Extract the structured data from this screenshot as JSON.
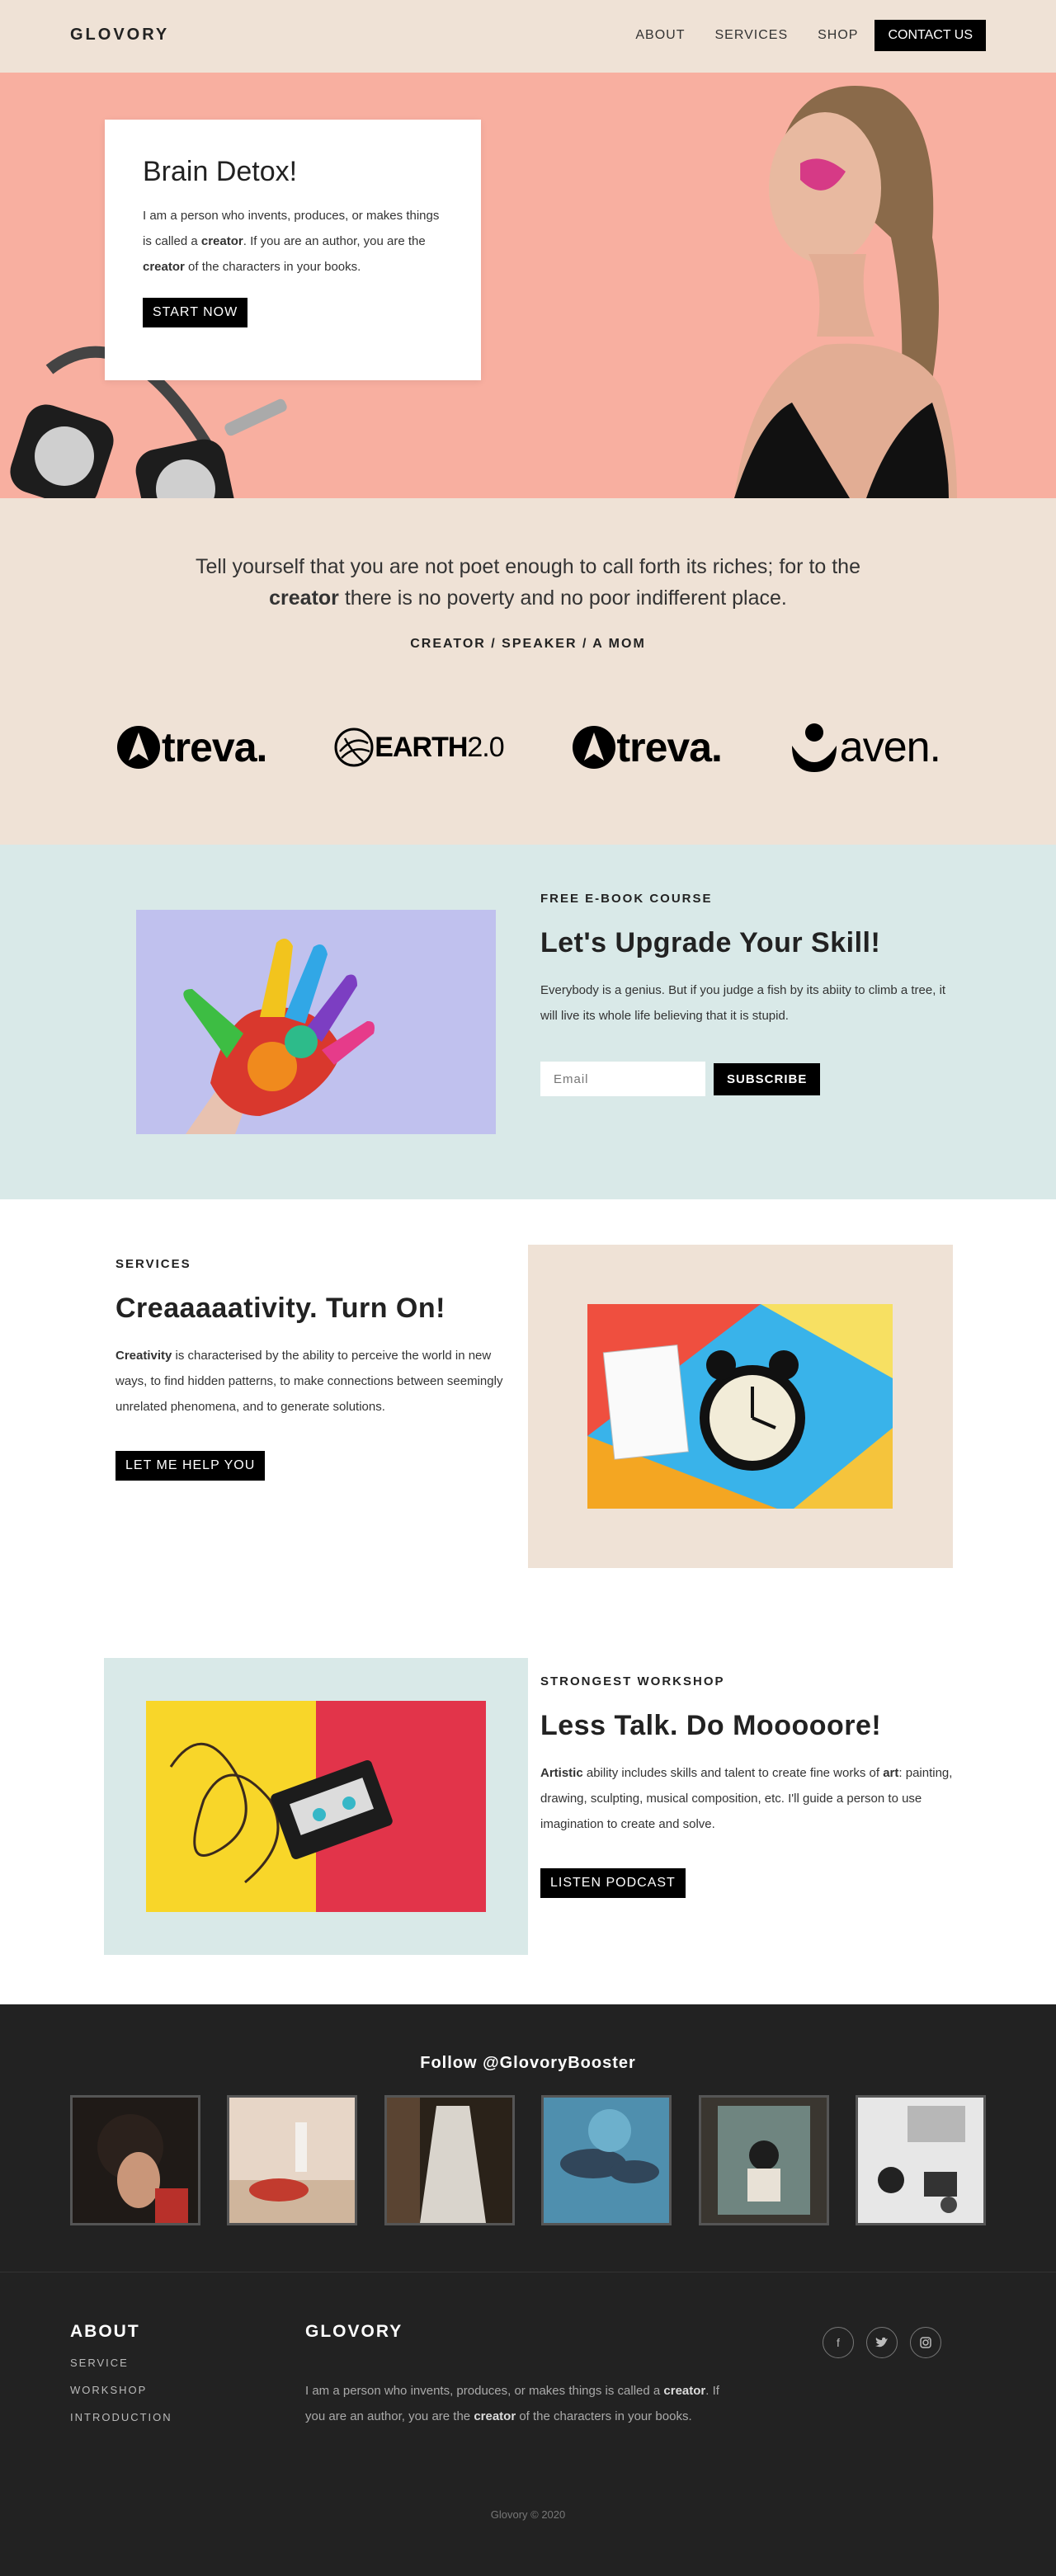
{
  "header": {
    "logo": "GLOVORY",
    "nav": [
      "ABOUT",
      "SERVICES",
      "SHOP"
    ],
    "contact": "CONTACT US"
  },
  "hero": {
    "title": "Brain Detox!",
    "text_1": "I am a person who invents, produces, or makes things is called a ",
    "text_bold_1": "creator",
    "text_2": ". If you are an author, you are the ",
    "text_bold_2": "creator",
    "text_3": " of the characters in your books.",
    "button": "START NOW"
  },
  "quote": {
    "text_1": "Tell yourself that you are not poet enough to call forth its riches; for to the ",
    "text_bold": "creator",
    "text_2": " there is no poverty and no poor indifferent place.",
    "subtitle": "CREATOR / SPEAKER / A MOM"
  },
  "brands": {
    "treva": "treva.",
    "earth_bold": "EARTH",
    "earth_light": "2.0",
    "aven": "aven."
  },
  "ebook": {
    "eyebrow": "FREE E-BOOK COURSE",
    "title": "Let's Upgrade Your Skill!",
    "text": "Everybody is a genius. But if you judge a fish by its abiity to climb a tree, it will live its whole life believing that it is stupid.",
    "email_placeholder": "Email",
    "button": "SUBSCRIBE"
  },
  "services": {
    "eyebrow": "SERVICES",
    "title": "Creaaaaativity. Turn On!",
    "text_bold": "Creativity",
    "text": " is characterised by the ability to perceive the world in new ways, to find hidden patterns, to make connections between seemingly unrelated phenomena, and to generate solutions.",
    "button": "LET ME HELP YOU"
  },
  "workshop": {
    "eyebrow": "STRONGEST WORKSHOP",
    "title": "Less Talk. Do Mooooore!",
    "text_bold_1": "Artistic",
    "text_1": " ability includes skills and talent to create fine works of ",
    "text_bold_2": "art",
    "text_2": ": painting, drawing, sculpting, musical composition, etc. I'll guide a person to use imagination to create and solve.",
    "button": "LISTEN PODCAST"
  },
  "instagram": {
    "title": "Follow @GlovoryBooster"
  },
  "footer": {
    "about_heading": "ABOUT",
    "links": [
      "SERVICE",
      "WORKSHOP",
      "INTRODUCTION"
    ],
    "brand_heading": "GLOVORY",
    "text_1": "I am a person who invents, produces, or makes things is called a ",
    "text_bold_1": "creator",
    "text_2": ". If you are an author, you are the ",
    "text_bold_2": "creator",
    "text_3": " of the characters in your books.",
    "social": [
      "facebook-icon",
      "twitter-icon",
      "instagram-icon"
    ],
    "copyright": "Glovory © 2020"
  }
}
